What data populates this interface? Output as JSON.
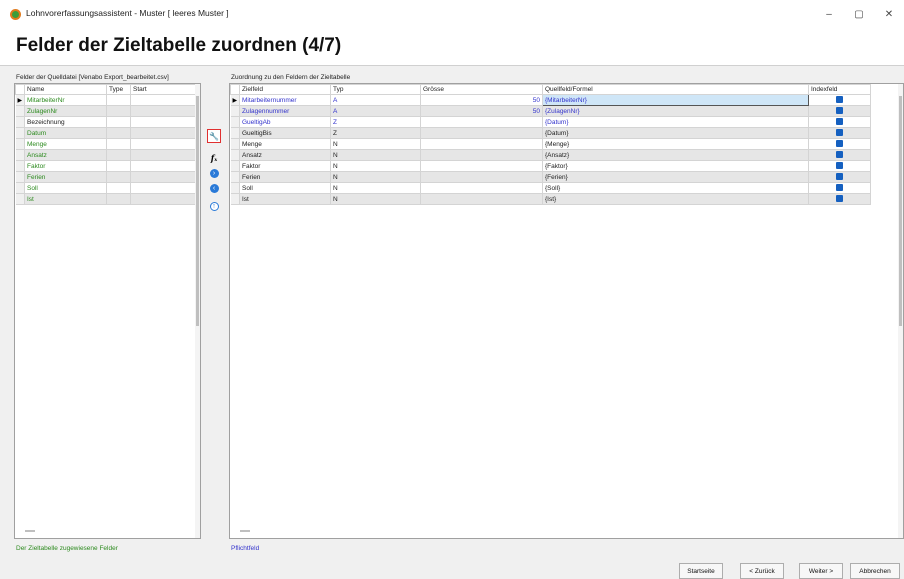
{
  "window": {
    "title": "Lohnvorerfassungsassistent - Muster [ leeres Muster ]",
    "minimize": "–",
    "maximize": "▢",
    "close": "✕"
  },
  "header": {
    "title": "Felder der Zieltabelle zuordnen (4/7)"
  },
  "source": {
    "caption": "Felder der Quelldatei [Venabo Export_bearbeitet.csv]",
    "columns": [
      "Name",
      "Type",
      "Start"
    ],
    "rows": [
      {
        "name": "MitarbeiterNr",
        "color": "green",
        "current": true
      },
      {
        "name": "ZulagenNr",
        "color": "green"
      },
      {
        "name": "Bezeichnung",
        "color": "black"
      },
      {
        "name": "Datum",
        "color": "green"
      },
      {
        "name": "Menge",
        "color": "green"
      },
      {
        "name": "Ansatz",
        "color": "green"
      },
      {
        "name": "Faktor",
        "color": "green"
      },
      {
        "name": "Ferien",
        "color": "green"
      },
      {
        "name": "Soll",
        "color": "green"
      },
      {
        "name": "Ist",
        "color": "green"
      }
    ],
    "footer": "Der Zieltabelle zugewiesene Felder",
    "footer_color": "#2c8a1e"
  },
  "tools": [
    {
      "name": "assign-wand-icon",
      "glyph": "🔧"
    },
    {
      "name": "formula-icon",
      "glyph": "fx"
    },
    {
      "name": "arrow-right-circle-icon",
      "glyph": "➔"
    },
    {
      "name": "arrow-left-circle-icon",
      "glyph": "◀"
    },
    {
      "name": "arrow-up-circle-icon",
      "glyph": "▲"
    }
  ],
  "target": {
    "caption": "Zuordnung zu den Feldern der Zieltabelle",
    "columns": [
      "Zielfeld",
      "Typ",
      "Grösse",
      "Quellfeld/Formel",
      "Indexfeld"
    ],
    "rows": [
      {
        "field": "Mitarbeiternummer",
        "type": "A",
        "size": "50",
        "source": "{MitarbeiterNr}",
        "color": "blue",
        "current": true,
        "index": true
      },
      {
        "field": "Zulagennummer",
        "type": "A",
        "size": "50",
        "source": "{ZulagenNr}",
        "color": "blue",
        "index": true
      },
      {
        "field": "GueltigAb",
        "type": "Z",
        "size": "",
        "source": "{Datum}",
        "color": "blue",
        "index": true
      },
      {
        "field": "GueltigBis",
        "type": "Z",
        "size": "",
        "source": "{Datum}",
        "color": "black",
        "index": true
      },
      {
        "field": "Menge",
        "type": "N",
        "size": "",
        "source": "{Menge}",
        "color": "black",
        "index": true
      },
      {
        "field": "Ansatz",
        "type": "N",
        "size": "",
        "source": "{Ansatz}",
        "color": "black",
        "index": true
      },
      {
        "field": "Faktor",
        "type": "N",
        "size": "",
        "source": "{Faktor}",
        "color": "black",
        "index": true
      },
      {
        "field": "Ferien",
        "type": "N",
        "size": "",
        "source": "{Ferien}",
        "color": "black",
        "index": true
      },
      {
        "field": "Soll",
        "type": "N",
        "size": "",
        "source": "{Soll}",
        "color": "black",
        "index": true
      },
      {
        "field": "Ist",
        "type": "N",
        "size": "",
        "source": "{Ist}",
        "color": "black",
        "index": true
      }
    ],
    "footer": "Pflichtfeld",
    "footer_color": "#3333cc"
  },
  "buttons": {
    "start": "Startseite",
    "back": "< Zurück",
    "next": "Weiter >",
    "cancel": "Abbrechen"
  }
}
